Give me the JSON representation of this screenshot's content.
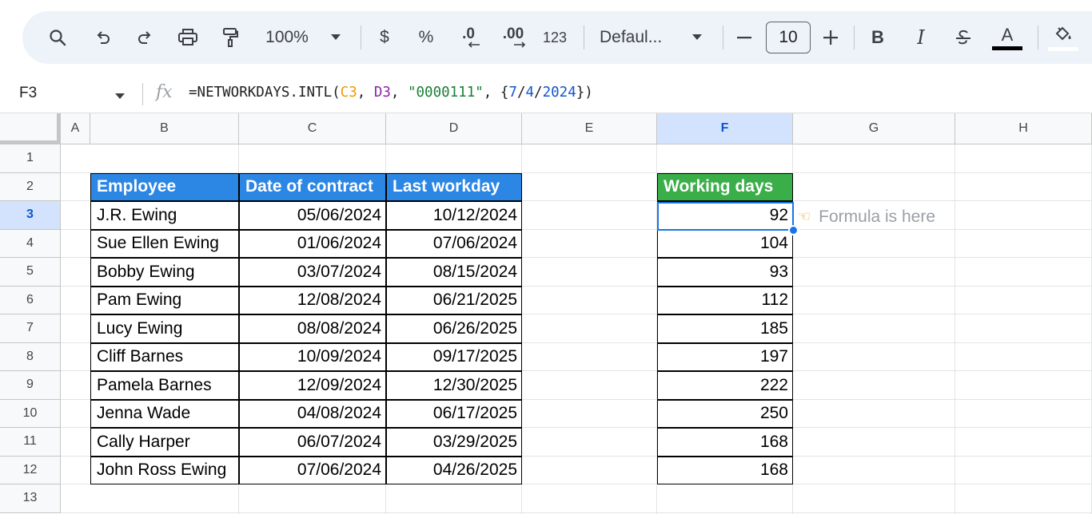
{
  "toolbar": {
    "zoom": "100%",
    "currency": "$",
    "percent": "%",
    "decimal_decrease": ".0",
    "decimal_increase": ".00",
    "number_format": "123",
    "font_family": "Defaul...",
    "font_size": "10",
    "bold": "B",
    "italic": "I",
    "text_color_label": "A"
  },
  "formula_bar": {
    "cell_ref": "F3",
    "fx": "fx",
    "formula_parts": [
      "=NETWORKDAYS.INTL(",
      "C3",
      ", ",
      "D3",
      ", ",
      "\"0000111\"",
      ", {",
      "7",
      "/",
      "4",
      "/",
      "2024",
      "})"
    ]
  },
  "columns": [
    "A",
    "B",
    "C",
    "D",
    "E",
    "F",
    "G",
    "H"
  ],
  "rows": [
    "1",
    "2",
    "3",
    "4",
    "5",
    "6",
    "7",
    "8",
    "9",
    "10",
    "11",
    "12",
    "13"
  ],
  "table": {
    "headers": [
      "Employee",
      "Date of contract",
      "Last workday"
    ],
    "rows": [
      [
        "J.R. Ewing",
        "05/06/2024",
        "10/12/2024"
      ],
      [
        "Sue Ellen Ewing",
        "01/06/2024",
        "07/06/2024"
      ],
      [
        "Bobby Ewing",
        "03/07/2024",
        "08/15/2024"
      ],
      [
        "Pam Ewing",
        "12/08/2024",
        "06/21/2025"
      ],
      [
        "Lucy Ewing",
        "08/08/2024",
        "06/26/2025"
      ],
      [
        "Cliff Barnes",
        "10/09/2024",
        "09/17/2025"
      ],
      [
        "Pamela Barnes",
        "12/09/2024",
        "12/30/2025"
      ],
      [
        "Jenna Wade",
        "04/08/2024",
        "06/17/2025"
      ],
      [
        "Cally Harper",
        "06/07/2024",
        "03/29/2025"
      ],
      [
        "John Ross Ewing",
        "07/06/2024",
        "04/26/2025"
      ]
    ]
  },
  "result": {
    "header": "Working days",
    "values": [
      "92",
      "104",
      "93",
      "112",
      "185",
      "197",
      "222",
      "250",
      "168",
      "168"
    ]
  },
  "annotation": {
    "text": "Formula is here",
    "icon": "pointing-hand-icon"
  },
  "colors": {
    "header_blue": "#2b86e4",
    "header_green": "#3aae49",
    "selection": "#1a73e8"
  }
}
